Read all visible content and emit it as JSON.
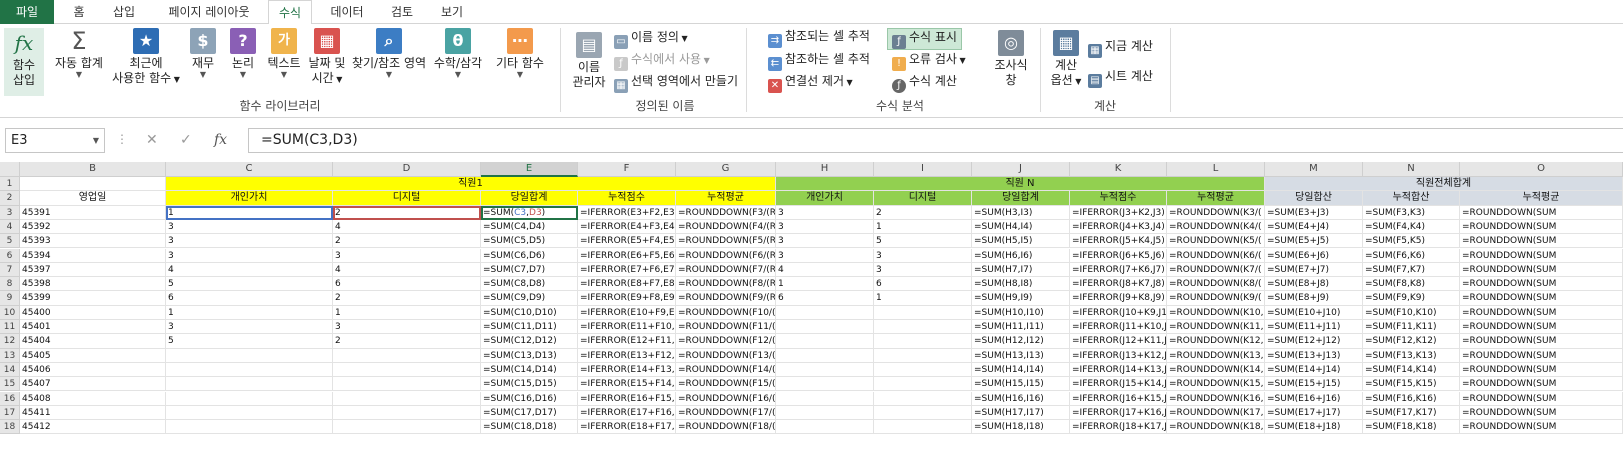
{
  "tabs": [
    "파일",
    "홈",
    "삽입",
    "페이지 레이아웃",
    "수식",
    "데이터",
    "검토",
    "보기"
  ],
  "ribbon": {
    "insert_function": {
      "l1": "함수",
      "l2": "삽입"
    },
    "autosum": {
      "l1": "자동 합계"
    },
    "recent": {
      "l1": "최근에",
      "l2": "사용한 함수"
    },
    "financial": {
      "l1": "재무"
    },
    "logical": {
      "l1": "논리"
    },
    "text": {
      "l1": "텍스트"
    },
    "datetime": {
      "l1": "날짜 및",
      "l2": "시간"
    },
    "lookup": {
      "l1": "찾기/참조 영역"
    },
    "math": {
      "l1": "수학/삼각"
    },
    "more": {
      "l1": "기타 함수"
    },
    "group_library": "함수 라이브러리",
    "name_manager": {
      "l1": "이름",
      "l2": "관리자"
    },
    "define_name": "이름 정의",
    "use_in_formula": "수식에서 사용",
    "create_from_selection": "선택 영역에서 만들기",
    "group_names": "정의된 이름",
    "trace_precedents": "참조되는 셀 추적",
    "trace_dependents": "참조하는 셀 추적",
    "remove_arrows": "연결선 제거",
    "show_formulas": "수식 표시",
    "error_checking": "오류 검사",
    "evaluate_formula": "수식 계산",
    "watch_window": {
      "l1": "조사식",
      "l2": "창"
    },
    "group_audit": "수식 분석",
    "calc_options": {
      "l1": "계산",
      "l2": "옵션"
    },
    "calc_now": "지금 계산",
    "calc_sheet": "시트 계산",
    "group_calc": "계산"
  },
  "formula_bar": {
    "name_box": "E3",
    "formula": "=SUM(C3,D3)",
    "fx": "fx"
  },
  "columns": [
    "B",
    "C",
    "D",
    "E",
    "F",
    "G",
    "H",
    "I",
    "J",
    "K",
    "L",
    "M",
    "N",
    "O"
  ],
  "row_numbers": [
    "1",
    "2",
    "3",
    "4",
    "5",
    "6",
    "7",
    "8",
    "9",
    "10",
    "11",
    "12",
    "13",
    "14",
    "15",
    "16",
    "17",
    "18"
  ],
  "headers": {
    "row1": {
      "emp1": "직원1",
      "empN": "직원 N",
      "total": "직원전체합계"
    },
    "row2": [
      "영업일",
      "개인가치",
      "디지털",
      "당일합계",
      "누적점수",
      "누적평균",
      "개인가치",
      "디지털",
      "당일합계",
      "누적점수",
      "누적평균",
      "당일합산",
      "누적합산",
      "누적평균"
    ]
  },
  "rows": [
    {
      "B": "45391",
      "C": "1",
      "D": "2",
      "E": "=SUM(C3,D3)",
      "F": "=IFERROR(E3+F2,E3)",
      "G": "=ROUNDDOWN(F3/(R",
      "H": "3",
      "I": "2",
      "J": "=SUM(H3,I3)",
      "K": "=IFERROR(J3+K2,J3)",
      "L": "=ROUNDDOWN(K3/(",
      "M": "=SUM(E3+J3)",
      "N": "=SUM(F3,K3)",
      "O": "=ROUNDDOWN(SUM"
    },
    {
      "B": "45392",
      "C": "3",
      "D": "4",
      "E": "=SUM(C4,D4)",
      "F": "=IFERROR(E4+F3,E4)",
      "G": "=ROUNDDOWN(F4/(R",
      "H": "3",
      "I": "1",
      "J": "=SUM(H4,I4)",
      "K": "=IFERROR(J4+K3,J4)",
      "L": "=ROUNDDOWN(K4/(",
      "M": "=SUM(E4+J4)",
      "N": "=SUM(F4,K4)",
      "O": "=ROUNDDOWN(SUM"
    },
    {
      "B": "45393",
      "C": "3",
      "D": "2",
      "E": "=SUM(C5,D5)",
      "F": "=IFERROR(E5+F4,E5)",
      "G": "=ROUNDDOWN(F5/(R",
      "H": "3",
      "I": "5",
      "J": "=SUM(H5,I5)",
      "K": "=IFERROR(J5+K4,J5)",
      "L": "=ROUNDDOWN(K5/(",
      "M": "=SUM(E5+J5)",
      "N": "=SUM(F5,K5)",
      "O": "=ROUNDDOWN(SUM"
    },
    {
      "B": "45394",
      "C": "3",
      "D": "3",
      "E": "=SUM(C6,D6)",
      "F": "=IFERROR(E6+F5,E6)",
      "G": "=ROUNDDOWN(F6/(R",
      "H": "3",
      "I": "3",
      "J": "=SUM(H6,I6)",
      "K": "=IFERROR(J6+K5,J6)",
      "L": "=ROUNDDOWN(K6/(",
      "M": "=SUM(E6+J6)",
      "N": "=SUM(F6,K6)",
      "O": "=ROUNDDOWN(SUM"
    },
    {
      "B": "45397",
      "C": "4",
      "D": "4",
      "E": "=SUM(C7,D7)",
      "F": "=IFERROR(E7+F6,E7)",
      "G": "=ROUNDDOWN(F7/(R",
      "H": "4",
      "I": "3",
      "J": "=SUM(H7,I7)",
      "K": "=IFERROR(J7+K6,J7)",
      "L": "=ROUNDDOWN(K7/(",
      "M": "=SUM(E7+J7)",
      "N": "=SUM(F7,K7)",
      "O": "=ROUNDDOWN(SUM"
    },
    {
      "B": "45398",
      "C": "5",
      "D": "6",
      "E": "=SUM(C8,D8)",
      "F": "=IFERROR(E8+F7,E8)",
      "G": "=ROUNDDOWN(F8/(R",
      "H": "1",
      "I": "6",
      "J": "=SUM(H8,I8)",
      "K": "=IFERROR(J8+K7,J8)",
      "L": "=ROUNDDOWN(K8/(",
      "M": "=SUM(E8+J8)",
      "N": "=SUM(F8,K8)",
      "O": "=ROUNDDOWN(SUM"
    },
    {
      "B": "45399",
      "C": "6",
      "D": "2",
      "E": "=SUM(C9,D9)",
      "F": "=IFERROR(E9+F8,E9)",
      "G": "=ROUNDDOWN(F9/(R",
      "H": "6",
      "I": "1",
      "J": "=SUM(H9,I9)",
      "K": "=IFERROR(J9+K8,J9)",
      "L": "=ROUNDDOWN(K9/(",
      "M": "=SUM(E8+J9)",
      "N": "=SUM(F9,K9)",
      "O": "=ROUNDDOWN(SUM"
    },
    {
      "B": "45400",
      "C": "1",
      "D": "1",
      "E": "=SUM(C10,D10)",
      "F": "=IFERROR(E10+F9,E1",
      "G": "=ROUNDDOWN(F10/(",
      "H": "",
      "I": "",
      "J": "=SUM(H10,I10)",
      "K": "=IFERROR(J10+K9,J1",
      "L": "=ROUNDDOWN(K10,",
      "M": "=SUM(E10+J10)",
      "N": "=SUM(F10,K10)",
      "O": "=ROUNDDOWN(SUM"
    },
    {
      "B": "45401",
      "C": "3",
      "D": "3",
      "E": "=SUM(C11,D11)",
      "F": "=IFERROR(E11+F10,E",
      "G": "=ROUNDDOWN(F11/(",
      "H": "",
      "I": "",
      "J": "=SUM(H11,I11)",
      "K": "=IFERROR(J11+K10,J",
      "L": "=ROUNDDOWN(K11,",
      "M": "=SUM(E11+J11)",
      "N": "=SUM(F11,K11)",
      "O": "=ROUNDDOWN(SUM"
    },
    {
      "B": "45404",
      "C": "5",
      "D": "2",
      "E": "=SUM(C12,D12)",
      "F": "=IFERROR(E12+F11,E",
      "G": "=ROUNDDOWN(F12/(",
      "H": "",
      "I": "",
      "J": "=SUM(H12,I12)",
      "K": "=IFERROR(J12+K11,J",
      "L": "=ROUNDDOWN(K12,",
      "M": "=SUM(E12+J12)",
      "N": "=SUM(F12,K12)",
      "O": "=ROUNDDOWN(SUM"
    },
    {
      "B": "45405",
      "C": "",
      "D": "",
      "E": "=SUM(C13,D13)",
      "F": "=IFERROR(E13+F12,E",
      "G": "=ROUNDDOWN(F13/(",
      "H": "",
      "I": "",
      "J": "=SUM(H13,I13)",
      "K": "=IFERROR(J13+K12,J",
      "L": "=ROUNDDOWN(K13,",
      "M": "=SUM(E13+J13)",
      "N": "=SUM(F13,K13)",
      "O": "=ROUNDDOWN(SUM"
    },
    {
      "B": "45406",
      "C": "",
      "D": "",
      "E": "=SUM(C14,D14)",
      "F": "=IFERROR(E14+F13,E",
      "G": "=ROUNDDOWN(F14/(",
      "H": "",
      "I": "",
      "J": "=SUM(H14,I14)",
      "K": "=IFERROR(J14+K13,J",
      "L": "=ROUNDDOWN(K14,",
      "M": "=SUM(E14+J14)",
      "N": "=SUM(F14,K14)",
      "O": "=ROUNDDOWN(SUM"
    },
    {
      "B": "45407",
      "C": "",
      "D": "",
      "E": "=SUM(C15,D15)",
      "F": "=IFERROR(E15+F14,E",
      "G": "=ROUNDDOWN(F15/(",
      "H": "",
      "I": "",
      "J": "=SUM(H15,I15)",
      "K": "=IFERROR(J15+K14,J",
      "L": "=ROUNDDOWN(K15,",
      "M": "=SUM(E15+J15)",
      "N": "=SUM(F15,K15)",
      "O": "=ROUNDDOWN(SUM"
    },
    {
      "B": "45408",
      "C": "",
      "D": "",
      "E": "=SUM(C16,D16)",
      "F": "=IFERROR(E16+F15,E",
      "G": "=ROUNDDOWN(F16/(",
      "H": "",
      "I": "",
      "J": "=SUM(H16,I16)",
      "K": "=IFERROR(J16+K15,J",
      "L": "=ROUNDDOWN(K16,",
      "M": "=SUM(E16+J16)",
      "N": "=SUM(F16,K16)",
      "O": "=ROUNDDOWN(SUM"
    },
    {
      "B": "45411",
      "C": "",
      "D": "",
      "E": "=SUM(C17,D17)",
      "F": "=IFERROR(E17+F16,E",
      "G": "=ROUNDDOWN(F17/(",
      "H": "",
      "I": "",
      "J": "=SUM(H17,I17)",
      "K": "=IFERROR(J17+K16,J",
      "L": "=ROUNDDOWN(K17,",
      "M": "=SUM(E17+J17)",
      "N": "=SUM(F17,K17)",
      "O": "=ROUNDDOWN(SUM"
    },
    {
      "B": "45412",
      "C": "",
      "D": "",
      "E": "=SUM(C18,D18)",
      "F": "=IFERROR(E18+F17,E",
      "G": "=ROUNDDOWN(F18/(",
      "H": "",
      "I": "",
      "J": "=SUM(H18,I18)",
      "K": "=IFERROR(J18+K17,J",
      "L": "=ROUNDDOWN(K18,",
      "M": "=SUM(E18+J18)",
      "N": "=SUM(F18,K18)",
      "O": "=ROUNDDOWN(SUM"
    }
  ],
  "colors": {
    "accent": "#217346",
    "yellow": "#ffff00",
    "green": "#92d050",
    "slate": "#d6dce4"
  }
}
